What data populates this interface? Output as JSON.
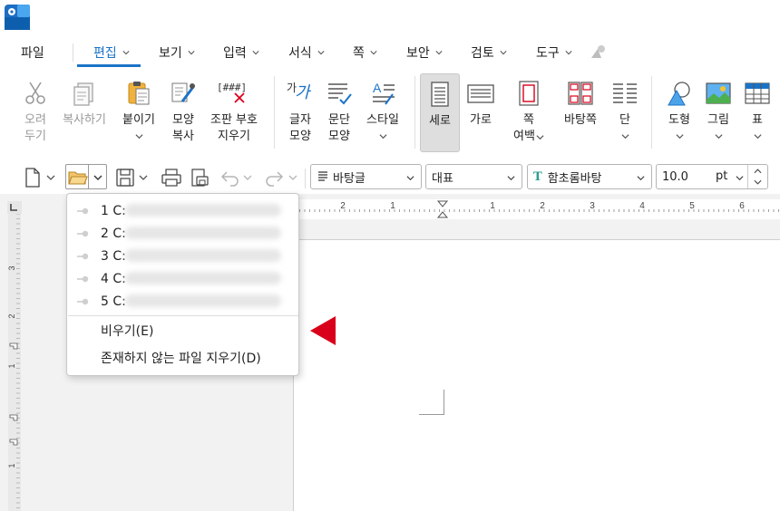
{
  "menu": {
    "items": [
      {
        "label": "파일",
        "active": false,
        "has_chevron": false
      },
      {
        "label": "편집",
        "active": true,
        "has_chevron": true
      },
      {
        "label": "보기",
        "active": false,
        "has_chevron": true
      },
      {
        "label": "입력",
        "active": false,
        "has_chevron": true
      },
      {
        "label": "서식",
        "active": false,
        "has_chevron": true
      },
      {
        "label": "쪽",
        "active": false,
        "has_chevron": true
      },
      {
        "label": "보안",
        "active": false,
        "has_chevron": true
      },
      {
        "label": "검토",
        "active": false,
        "has_chevron": true
      },
      {
        "label": "도구",
        "active": false,
        "has_chevron": true
      }
    ],
    "accent": "#1a73c7"
  },
  "ribbon": {
    "cut": {
      "line1": "오려",
      "line2": "두기",
      "icon": "scissors-icon"
    },
    "copy": {
      "line1": "복사하기",
      "icon": "copy-icon"
    },
    "paste": {
      "line1": "붙이기",
      "icon": "paste-icon"
    },
    "format_copy": {
      "line1": "모양",
      "line2": "복사",
      "icon": "format-painter-icon"
    },
    "clear_marks": {
      "line1": "조판 부호",
      "line2": "지우기",
      "icon_text": "[###]",
      "icon": "clear-marks-icon"
    },
    "char_shape": {
      "line1": "글자",
      "line2": "모양",
      "icon_text": "가",
      "icon": "char-shape-icon"
    },
    "para_shape": {
      "line1": "문단",
      "line2": "모양",
      "icon": "para-shape-icon"
    },
    "style": {
      "line1": "스타일",
      "icon": "style-icon"
    },
    "portrait": {
      "line1": "세로",
      "icon": "portrait-icon"
    },
    "landscape": {
      "line1": "가로",
      "icon": "landscape-icon"
    },
    "page_margin": {
      "line1": "쪽",
      "line2": "여백",
      "icon": "page-margin-icon"
    },
    "background": {
      "line1": "바탕쪽",
      "icon": "background-page-icon"
    },
    "columns": {
      "line1": "단",
      "icon": "columns-icon"
    },
    "shape": {
      "line1": "도형",
      "icon": "shape-icon"
    },
    "picture": {
      "line1": "그림",
      "icon": "picture-icon"
    },
    "table": {
      "line1": "표",
      "icon": "table-icon"
    }
  },
  "toolbar": {
    "style_combo": "바탕글",
    "lang_combo": "대표",
    "font_combo": "함초롬바탕",
    "font_icon_text": "T",
    "size_value": "10.0",
    "size_unit": "pt"
  },
  "ruler": {
    "h_labels": [
      "2",
      "1",
      "1",
      "2",
      "3",
      "4",
      "5",
      "6"
    ],
    "v_labels": [
      "3",
      "2",
      "1",
      "1"
    ]
  },
  "recent_menu": {
    "items": [
      {
        "num": "1 C:"
      },
      {
        "num": "2 C:"
      },
      {
        "num": "3 C:"
      },
      {
        "num": "4 C:"
      },
      {
        "num": "5 C:"
      }
    ],
    "clear": "비우기(E)",
    "remove_missing": "존재하지 않는 파일 지우기(D)"
  },
  "colors": {
    "red_arrow": "#d9001b",
    "selected_bg": "#dedede"
  }
}
